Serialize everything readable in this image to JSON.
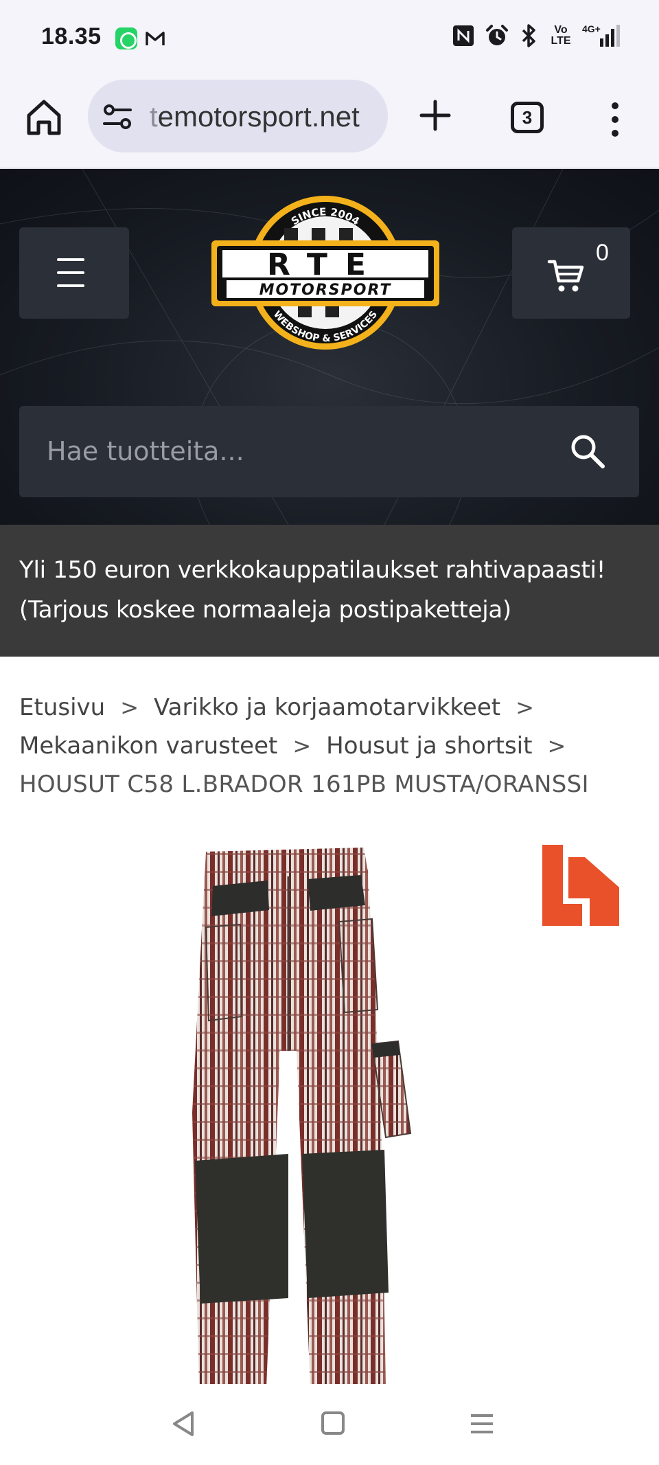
{
  "status_bar": {
    "time": "18.35",
    "left_icons": [
      "whatsapp-icon",
      "gmail-icon"
    ],
    "right_icons": [
      "nfc-icon",
      "alarm-icon",
      "bluetooth-icon",
      "volte-icon",
      "4g-signal-icon"
    ],
    "network_label": "4G+",
    "volte_top": "Vo",
    "volte_bottom": "LTE"
  },
  "browser": {
    "url_prefix": "t",
    "url_main": "emotorsport.net",
    "tab_count": "3"
  },
  "site_header": {
    "logo_text_top": "SINCE 2004",
    "logo_text_main": "RTE",
    "logo_text_sub": "MOTORSPORT",
    "logo_text_bottom": "WEBSHOP & SERVICES",
    "cart_count": "0",
    "search_placeholder": "Hae tuotteita..."
  },
  "promo": {
    "line1": "Yli 150 euron verkkokauppatilaukset rahtivapaasti!",
    "line2": "(Tarjous koskee normaaleja postipaketteja)"
  },
  "breadcrumb": {
    "items": [
      "Etusivu",
      "Varikko ja korjaamotarvikkeet",
      "Mekaanikon varusteet",
      "Housut ja shortsit"
    ],
    "separator": ">",
    "current": "HOUSUT C58 L.BRADOR 161PB MUSTA/ORANSSI"
  },
  "colors": {
    "accent_orange": "#e8512a",
    "logo_yellow": "#f3b11b",
    "header_bg": "#171b22",
    "promo_bg": "#3a3a3a"
  }
}
